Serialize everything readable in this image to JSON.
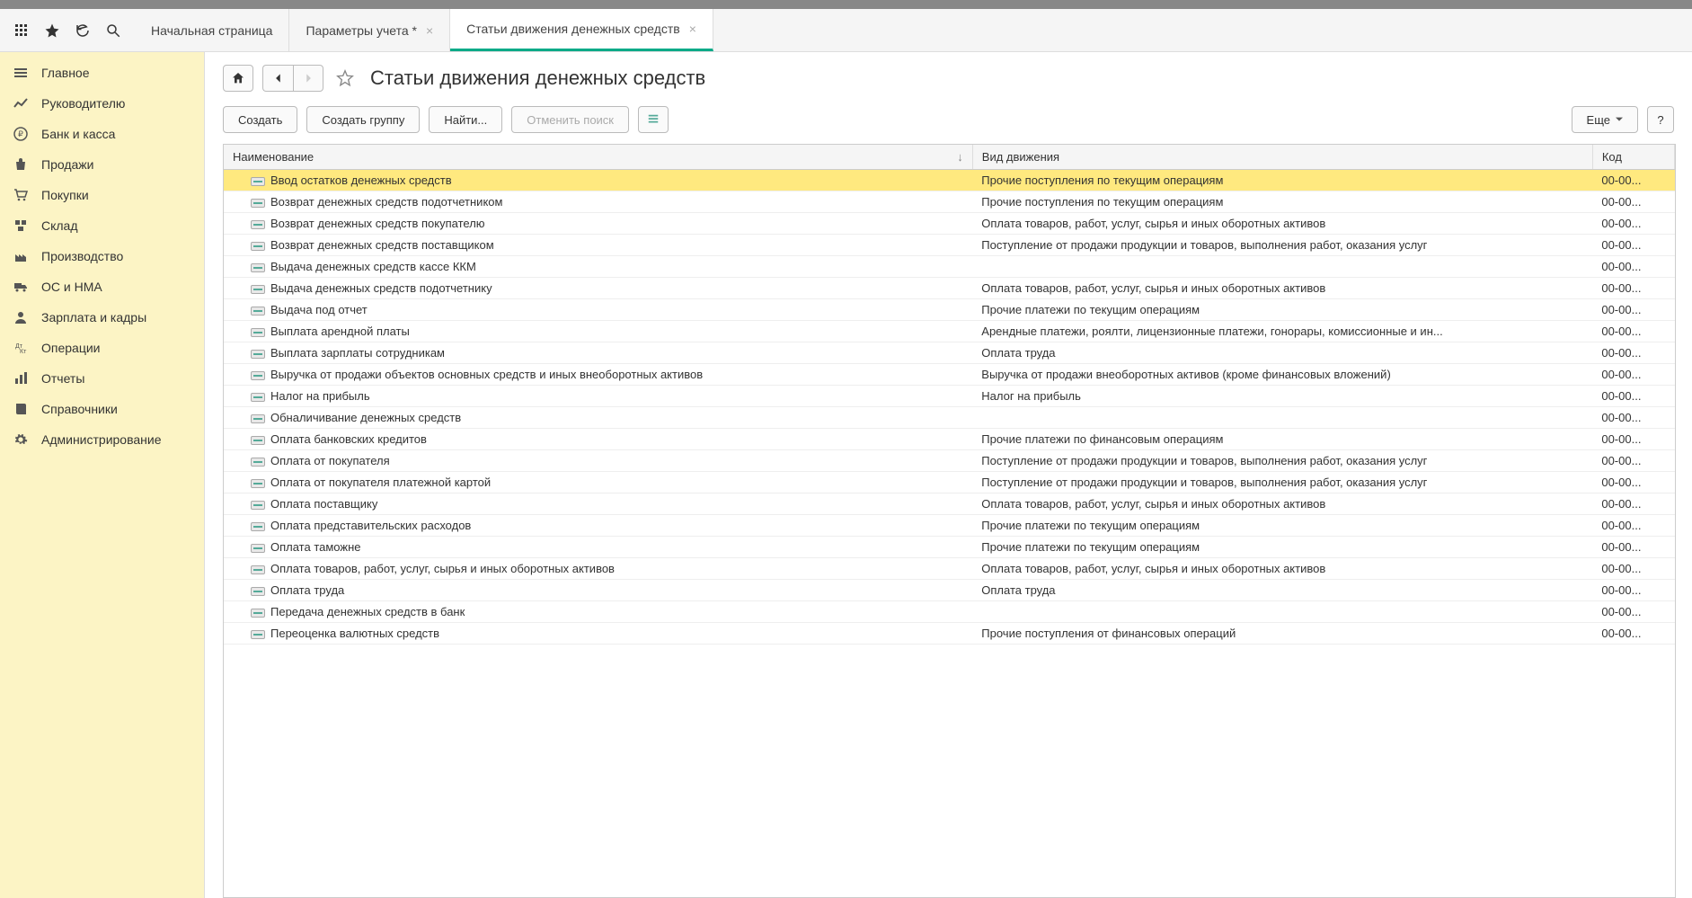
{
  "tabs": [
    {
      "label": "Начальная страница",
      "closable": false,
      "active": false
    },
    {
      "label": "Параметры учета *",
      "closable": true,
      "active": false
    },
    {
      "label": "Статьи движения денежных средств",
      "closable": true,
      "active": true
    }
  ],
  "sidebar": {
    "items": [
      {
        "icon": "menu",
        "label": "Главное"
      },
      {
        "icon": "trend",
        "label": "Руководителю"
      },
      {
        "icon": "ruble",
        "label": "Банк и касса"
      },
      {
        "icon": "bag",
        "label": "Продажи"
      },
      {
        "icon": "cart",
        "label": "Покупки"
      },
      {
        "icon": "stack",
        "label": "Склад"
      },
      {
        "icon": "factory",
        "label": "Производство"
      },
      {
        "icon": "truck",
        "label": "ОС и НМА"
      },
      {
        "icon": "person",
        "label": "Зарплата и кадры"
      },
      {
        "icon": "ops",
        "label": "Операции"
      },
      {
        "icon": "bars",
        "label": "Отчеты"
      },
      {
        "icon": "book",
        "label": "Справочники"
      },
      {
        "icon": "gear",
        "label": "Администрирование"
      }
    ]
  },
  "page": {
    "title": "Статьи движения денежных средств"
  },
  "toolbar": {
    "create": "Создать",
    "create_group": "Создать группу",
    "find": "Найти...",
    "cancel_search": "Отменить поиск",
    "more": "Еще",
    "help": "?"
  },
  "table": {
    "columns": {
      "name": "Наименование",
      "kind": "Вид движения",
      "code": "Код"
    },
    "sort_indicator": "↓",
    "rows": [
      {
        "name": "Ввод остатков денежных средств",
        "kind": "Прочие поступления по текущим операциям",
        "code": "00-00...",
        "selected": true
      },
      {
        "name": "Возврат денежных средств подотчетником",
        "kind": "Прочие поступления по текущим операциям",
        "code": "00-00..."
      },
      {
        "name": "Возврат денежных средств покупателю",
        "kind": "Оплата товаров, работ, услуг, сырья и иных оборотных активов",
        "code": "00-00..."
      },
      {
        "name": "Возврат денежных средств поставщиком",
        "kind": "Поступление от продажи продукции и товаров, выполнения работ, оказания услуг",
        "code": "00-00..."
      },
      {
        "name": "Выдача денежных средств кассе ККМ",
        "kind": "",
        "code": "00-00..."
      },
      {
        "name": "Выдача денежных средств подотчетнику",
        "kind": "Оплата товаров, работ, услуг, сырья и иных оборотных активов",
        "code": "00-00..."
      },
      {
        "name": "Выдача под отчет",
        "kind": "Прочие платежи по текущим операциям",
        "code": "00-00..."
      },
      {
        "name": "Выплата арендной платы",
        "kind": "Арендные платежи, роялти, лицензионные платежи, гонорары, комиссионные и ин...",
        "code": "00-00..."
      },
      {
        "name": "Выплата зарплаты сотрудникам",
        "kind": "Оплата труда",
        "code": "00-00..."
      },
      {
        "name": "Выручка от продажи объектов основных средств и иных внеоборотных активов",
        "kind": "Выручка от продажи внеоборотных активов (кроме финансовых вложений)",
        "code": "00-00..."
      },
      {
        "name": "Налог на прибыль",
        "kind": "Налог на прибыль",
        "code": "00-00..."
      },
      {
        "name": "Обналичивание денежных средств",
        "kind": "",
        "code": "00-00..."
      },
      {
        "name": "Оплата банковских кредитов",
        "kind": "Прочие платежи по финансовым операциям",
        "code": "00-00..."
      },
      {
        "name": "Оплата от покупателя",
        "kind": "Поступление от продажи продукции и товаров, выполнения работ, оказания услуг",
        "code": "00-00..."
      },
      {
        "name": "Оплата от покупателя платежной картой",
        "kind": "Поступление от продажи продукции и товаров, выполнения работ, оказания услуг",
        "code": "00-00..."
      },
      {
        "name": "Оплата поставщику",
        "kind": "Оплата товаров, работ, услуг, сырья и иных оборотных активов",
        "code": "00-00..."
      },
      {
        "name": "Оплата представительских расходов",
        "kind": "Прочие платежи по текущим операциям",
        "code": "00-00..."
      },
      {
        "name": "Оплата таможне",
        "kind": "Прочие платежи по текущим операциям",
        "code": "00-00..."
      },
      {
        "name": "Оплата товаров, работ, услуг, сырья и иных оборотных активов",
        "kind": "Оплата товаров, работ, услуг, сырья и иных оборотных активов",
        "code": "00-00..."
      },
      {
        "name": "Оплата труда",
        "kind": "Оплата труда",
        "code": "00-00..."
      },
      {
        "name": "Передача денежных средств в банк",
        "kind": "",
        "code": "00-00..."
      },
      {
        "name": "Переоценка валютных средств",
        "kind": "Прочие поступления от финансовых операций",
        "code": "00-00..."
      }
    ]
  }
}
